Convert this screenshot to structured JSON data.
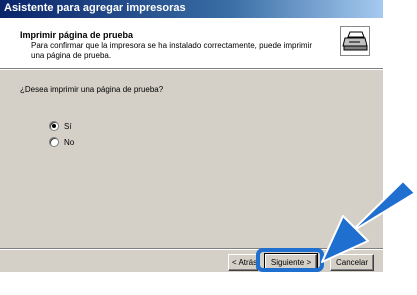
{
  "window": {
    "title": "Asistente para agregar impresoras"
  },
  "header": {
    "title": "Imprimir página de prueba",
    "subtitle": "Para confirmar que la impresora se ha instalado correctamente, puede imprimir una página de prueba.",
    "icon": "printer-wizard-icon"
  },
  "main": {
    "question": "¿Desea imprimir una página de prueba?",
    "options": [
      {
        "label": "Sí",
        "selected": true
      },
      {
        "label": "No",
        "selected": false
      }
    ]
  },
  "buttons": {
    "back_label": "< Atrás",
    "next_label": "Siguiente >",
    "cancel_label": "Cancelar"
  },
  "annotation": {
    "highlight_color": "#1f6fd0",
    "arrow_color": "#1f6fd0"
  }
}
